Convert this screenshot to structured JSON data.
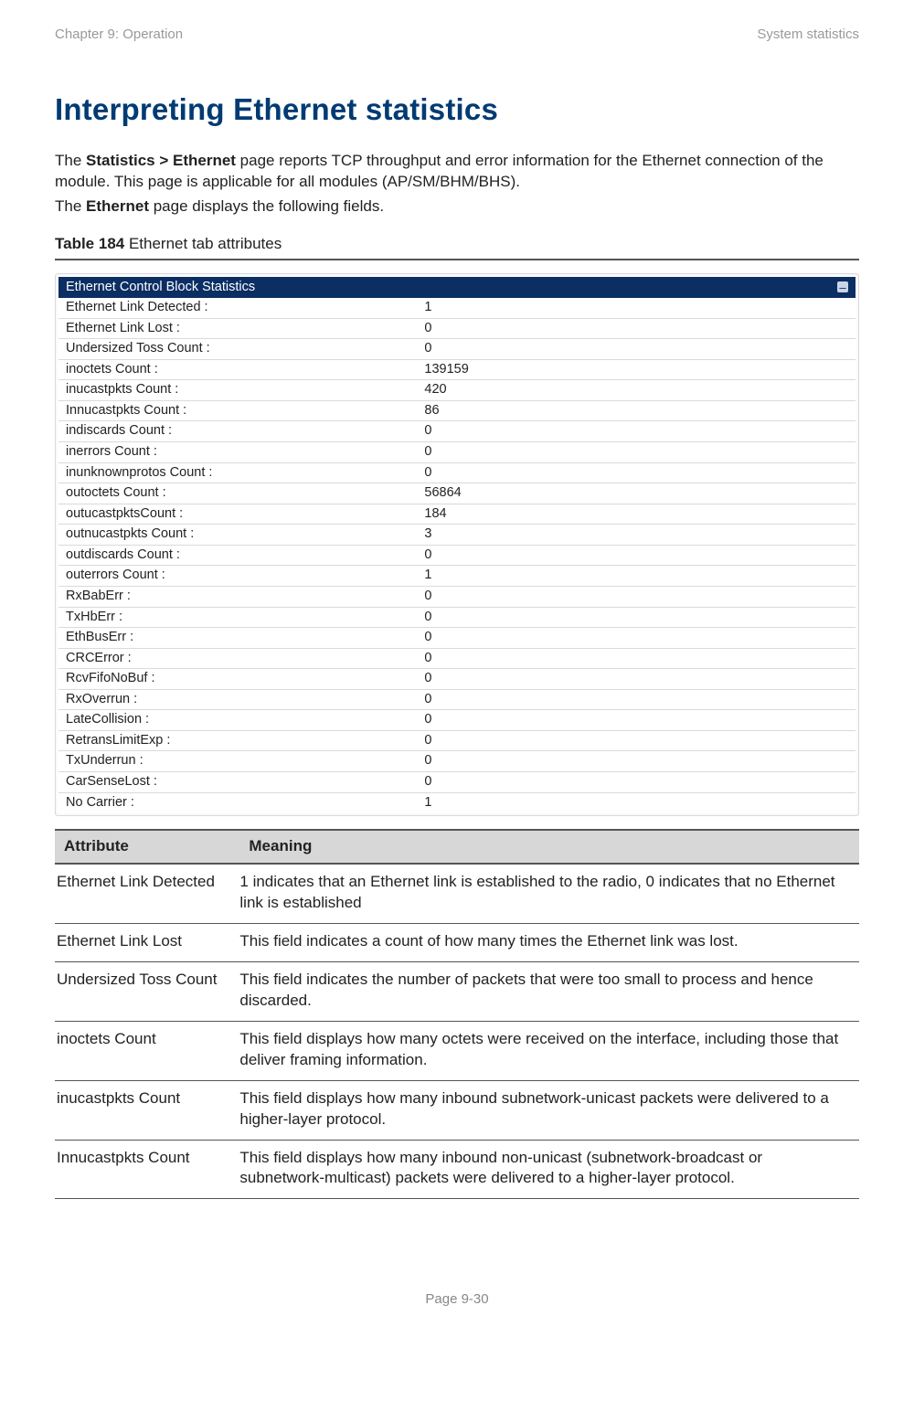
{
  "header": {
    "left": "Chapter 9:  Operation",
    "right": "System statistics"
  },
  "title": "Interpreting Ethernet statistics",
  "p1_a": "The ",
  "p1_b": "Statistics > Ethernet",
  "p1_c": " page reports TCP throughput and error information for the Ethernet connection of the module. This page is applicable for all modules (AP/SM/BHM/BHS).",
  "p2_a": "The ",
  "p2_b": "Ethernet",
  "p2_c": " page displays the following fields.",
  "table_label_bold": "Table 184",
  "table_label_rest": " Ethernet tab attributes",
  "panel_title": "Ethernet Control Block Statistics",
  "stats": [
    {
      "k": "Ethernet Link Detected :",
      "v": "1"
    },
    {
      "k": "Ethernet Link Lost :",
      "v": "0"
    },
    {
      "k": "Undersized Toss Count :",
      "v": "0"
    },
    {
      "k": "inoctets Count :",
      "v": "139159"
    },
    {
      "k": "inucastpkts Count :",
      "v": "420"
    },
    {
      "k": "Innucastpkts Count :",
      "v": "86"
    },
    {
      "k": "indiscards Count :",
      "v": "0"
    },
    {
      "k": "inerrors Count :",
      "v": "0"
    },
    {
      "k": "inunknownprotos Count :",
      "v": "0"
    },
    {
      "k": "outoctets Count :",
      "v": "56864"
    },
    {
      "k": "outucastpktsCount :",
      "v": "184"
    },
    {
      "k": "outnucastpkts Count :",
      "v": "3"
    },
    {
      "k": "outdiscards Count :",
      "v": "0"
    },
    {
      "k": "outerrors Count :",
      "v": "1"
    },
    {
      "k": "RxBabErr :",
      "v": "0"
    },
    {
      "k": "TxHbErr :",
      "v": "0"
    },
    {
      "k": "EthBusErr :",
      "v": "0"
    },
    {
      "k": "CRCError :",
      "v": "0"
    },
    {
      "k": "RcvFifoNoBuf :",
      "v": "0"
    },
    {
      "k": "RxOverrun :",
      "v": "0"
    },
    {
      "k": "LateCollision :",
      "v": "0"
    },
    {
      "k": "RetransLimitExp :",
      "v": "0"
    },
    {
      "k": "TxUnderrun :",
      "v": "0"
    },
    {
      "k": "CarSenseLost :",
      "v": "0"
    },
    {
      "k": "No Carrier :",
      "v": "1"
    }
  ],
  "attr_header": {
    "c1": "Attribute",
    "c2": "Meaning"
  },
  "attrs": [
    {
      "a": "Ethernet Link Detected",
      "m": "1 indicates that an Ethernet link is established to the radio, 0 indicates that no Ethernet link is established"
    },
    {
      "a": "Ethernet Link Lost",
      "m": "This field indicates a count of how many times the Ethernet link was lost."
    },
    {
      "a": "Undersized Toss Count",
      "m": "This field indicates the number of packets that were too small to process and hence discarded."
    },
    {
      "a": "inoctets Count",
      "m": "This field displays how many octets were received on the interface, including those that deliver framing information."
    },
    {
      "a": "inucastpkts Count",
      "m": "This field displays how many inbound subnetwork-unicast packets were delivered to a higher-layer protocol."
    },
    {
      "a": "Innucastpkts Count",
      "m": "This field displays how many inbound non-unicast (subnetwork-broadcast or subnetwork-multicast) packets were delivered to a higher-layer protocol."
    }
  ],
  "footer": "Page 9-30"
}
